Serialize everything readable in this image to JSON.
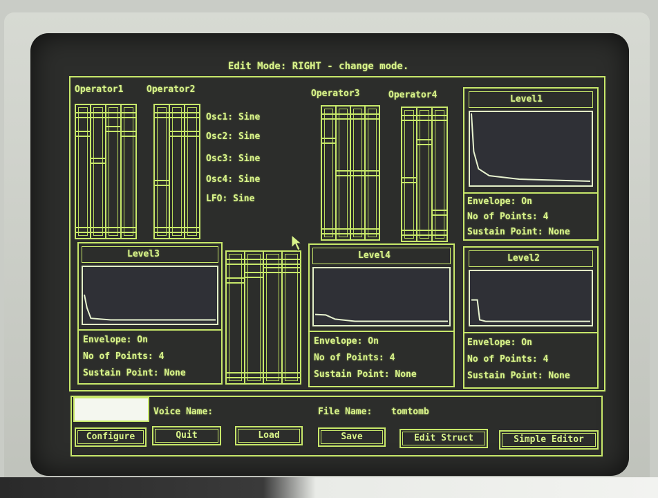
{
  "header": {
    "title": "Edit Mode:  RIGHT - change mode."
  },
  "operators": [
    {
      "label": "Operator1",
      "sliders": [
        0.15,
        0.4,
        0.1,
        0.15
      ]
    },
    {
      "label": "Operator2",
      "sliders": [
        0.6,
        0.15,
        0.15
      ]
    },
    {
      "label": "Operator3",
      "sliders": [
        0.2,
        0.5,
        0.5,
        0.5
      ]
    },
    {
      "label": "Operator4",
      "sliders": [
        0.55,
        0.2,
        0.85
      ]
    }
  ],
  "oscillators": [
    "Osc1: Sine",
    "Osc2: Sine",
    "Osc3: Sine",
    "Osc4: Sine",
    "LFO: Sine"
  ],
  "levels": {
    "level1": {
      "title": "Level1",
      "envelope": "Envelope: On",
      "points": "No of Points: 4",
      "sustain": "Sustain Point: None",
      "curve": [
        [
          0,
          1.0
        ],
        [
          0.02,
          0.45
        ],
        [
          0.06,
          0.2
        ],
        [
          0.15,
          0.1
        ],
        [
          0.4,
          0.05
        ],
        [
          1,
          0.02
        ]
      ]
    },
    "level3": {
      "title": "Level3",
      "envelope": "Envelope: On",
      "points": "No of Points: 4",
      "sustain": "Sustain Point: None",
      "curve": [
        [
          0,
          0.5
        ],
        [
          0.02,
          0.25
        ],
        [
          0.05,
          0.05
        ],
        [
          0.2,
          0.02
        ],
        [
          1,
          0.02
        ]
      ]
    },
    "level4": {
      "title": "Level4",
      "envelope": "Envelope: On",
      "points": "No of Points: 4",
      "sustain": "Sustain Point: None",
      "curve": [
        [
          0,
          0.15
        ],
        [
          0.08,
          0.14
        ],
        [
          0.15,
          0.06
        ],
        [
          0.3,
          0.02
        ],
        [
          1,
          0.02
        ]
      ]
    },
    "level2": {
      "title": "Level2",
      "envelope": "Envelope: On",
      "points": "No of Points: 4",
      "sustain": "Sustain Point: None",
      "curve": [
        [
          0,
          0.45
        ],
        [
          0.05,
          0.45
        ],
        [
          0.07,
          0.05
        ],
        [
          0.12,
          0.02
        ],
        [
          1,
          0.02
        ]
      ]
    }
  },
  "middle_sliders": [
    0.15,
    0.1,
    0.05,
    0.05
  ],
  "bottom": {
    "voice_label": "Voice Name:",
    "file_label": "File Name:",
    "file_value": "tomtomb",
    "buttons": {
      "configure": "Configure",
      "quit": "Quit",
      "load": "Load",
      "save": "Save",
      "edit_struct": "Edit Struct",
      "simple_editor": "Simple Editor"
    }
  }
}
